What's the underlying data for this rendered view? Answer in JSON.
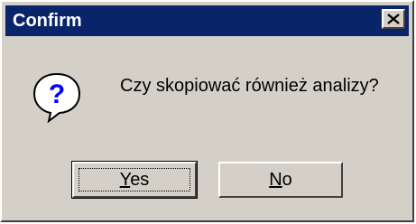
{
  "window": {
    "title": "Confirm",
    "close_glyph": "✕"
  },
  "message": "Czy skopiować również analizy?",
  "icon": "question-icon",
  "buttons": {
    "yes": "Yes",
    "no": "No"
  },
  "colors": {
    "titlebar": "#0a246a",
    "face": "#d4d0c8",
    "icon_blue": "#0000ff"
  }
}
